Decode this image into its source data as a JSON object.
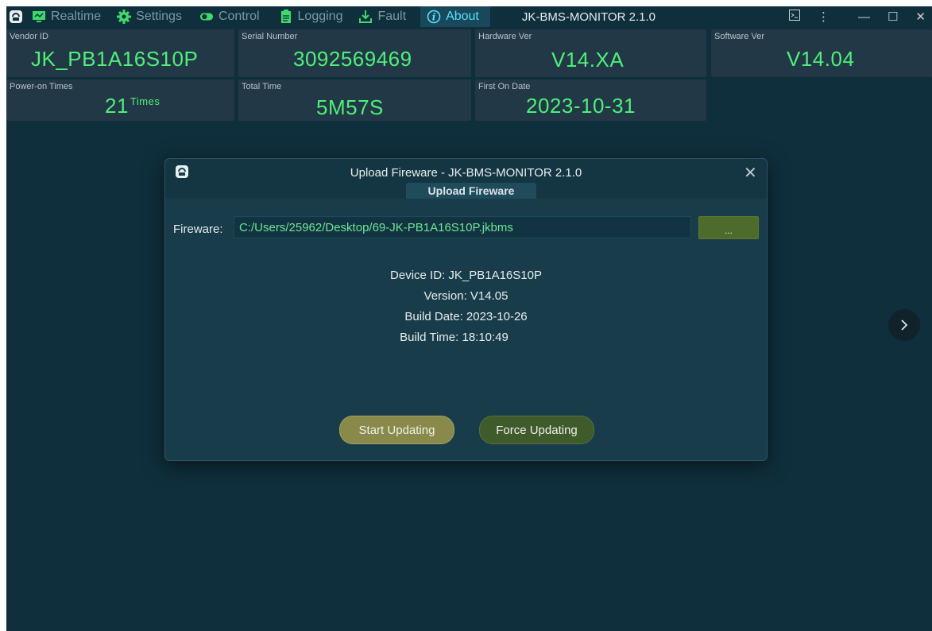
{
  "menu": {
    "items": [
      {
        "label": "Realtime",
        "icon": "monitor-icon"
      },
      {
        "label": "Settings",
        "icon": "gear-icon"
      },
      {
        "label": "Control",
        "icon": "toggle-icon"
      },
      {
        "label": "Logging",
        "icon": "clipboard-icon"
      },
      {
        "label": "Fault",
        "icon": "download-icon"
      },
      {
        "label": "About",
        "icon": "info-icon"
      }
    ],
    "active": "About",
    "app_title": "JK-BMS-MONITOR 2.1.0",
    "window_buttons": {
      "more": "⋮",
      "minimize": "—",
      "maximize": "☐",
      "close": "✕"
    }
  },
  "cards": {
    "vendor_id": {
      "label": "Vendor ID",
      "value": "JK_PB1A16S10P"
    },
    "serial_number": {
      "label": "Serial Number",
      "value": "3092569469"
    },
    "hardware_ver": {
      "label": "Hardware Ver",
      "value": "V14.XA"
    },
    "software_ver": {
      "label": "Software Ver",
      "value": "V14.04"
    },
    "power_on_times": {
      "label": "Power-on Times",
      "value": "21",
      "unit": "Times"
    },
    "total_time": {
      "label": "Total Time",
      "value": "5M57S"
    },
    "first_on_date": {
      "label": "First On Date",
      "value": "2023-10-31"
    }
  },
  "dialog": {
    "title": "Upload Fireware - JK-BMS-MONITOR 2.1.0",
    "tab": "Upload Fireware",
    "close": "✕",
    "fireware_label": "Fireware:",
    "fireware_path": "C:/Users/25962/Desktop/69-JK-PB1A16S10P.jkbms",
    "browse_label": "...",
    "device_id": "Device ID: JK_PB1A16S10P",
    "version": "Version: V14.05",
    "build_date": "Build Date: 2023-10-26",
    "build_time": "Build Time: 18:10:49",
    "start_label": "Start Updating",
    "force_label": "Force Updating"
  },
  "colors": {
    "background": "#0f2f3c",
    "card": "#223846",
    "value_green": "#4ef07a",
    "active_tab": "#59e0ff",
    "start_button": "#88894a",
    "force_button": "#3f5a2b"
  }
}
